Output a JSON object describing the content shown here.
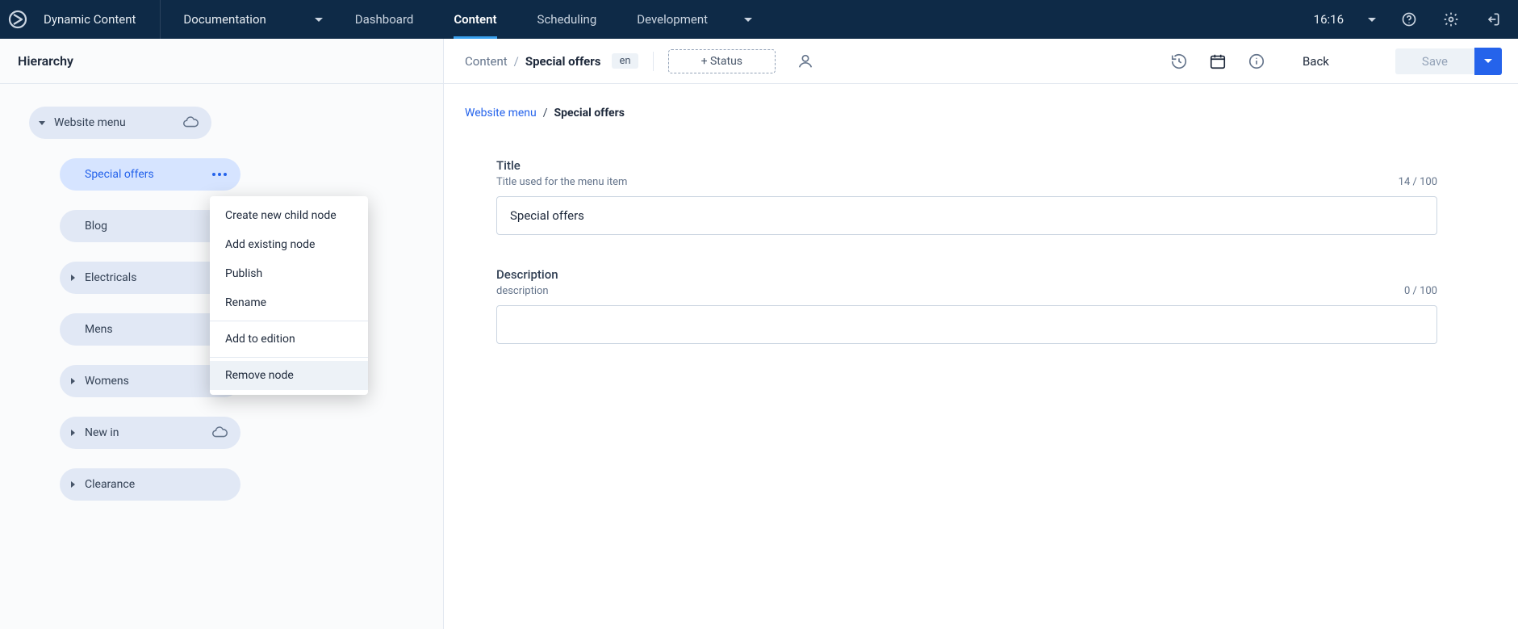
{
  "brand": "Dynamic Content",
  "nav": {
    "dropdown1": "Documentation",
    "tabs": [
      "Dashboard",
      "Content",
      "Scheduling"
    ],
    "active_tab": "Content",
    "dev": "Development",
    "time": "16:16"
  },
  "subheader": {
    "crumb_parent": "Content",
    "crumb_current": "Special offers",
    "lang": "en",
    "status_btn": "+ Status",
    "back_label": "Back",
    "save_label": "Save"
  },
  "sidebar": {
    "title": "Hierarchy",
    "root": {
      "label": "Website menu"
    },
    "children": [
      {
        "label": "Special offers",
        "selected": true,
        "has_caret": false,
        "icon": "none",
        "has_menu": true
      },
      {
        "label": "Blog",
        "selected": false,
        "has_caret": false,
        "icon": "cloud-x"
      },
      {
        "label": "Electricals",
        "selected": false,
        "has_caret": true,
        "icon": "cloud"
      },
      {
        "label": "Mens",
        "selected": false,
        "has_caret": false,
        "icon": "cloud"
      },
      {
        "label": "Womens",
        "selected": false,
        "has_caret": true,
        "icon": "cloud"
      },
      {
        "label": "New in",
        "selected": false,
        "has_caret": true,
        "icon": "cloud"
      },
      {
        "label": "Clearance",
        "selected": false,
        "has_caret": true,
        "icon": "none"
      }
    ]
  },
  "context_menu": {
    "items": [
      "Create new child node",
      "Add existing node",
      "Publish",
      "Rename"
    ],
    "after_divider": [
      "Add to edition"
    ],
    "after_divider2": [
      "Remove node"
    ],
    "hovered": "Remove node"
  },
  "main_crumb": {
    "parent": "Website menu",
    "current": "Special offers"
  },
  "form": {
    "title": {
      "label": "Title",
      "help": "Title used for the menu item",
      "value": "Special offers",
      "count": "14 / 100"
    },
    "description": {
      "label": "Description",
      "help": "description",
      "value": "",
      "count": "0 / 100"
    }
  }
}
